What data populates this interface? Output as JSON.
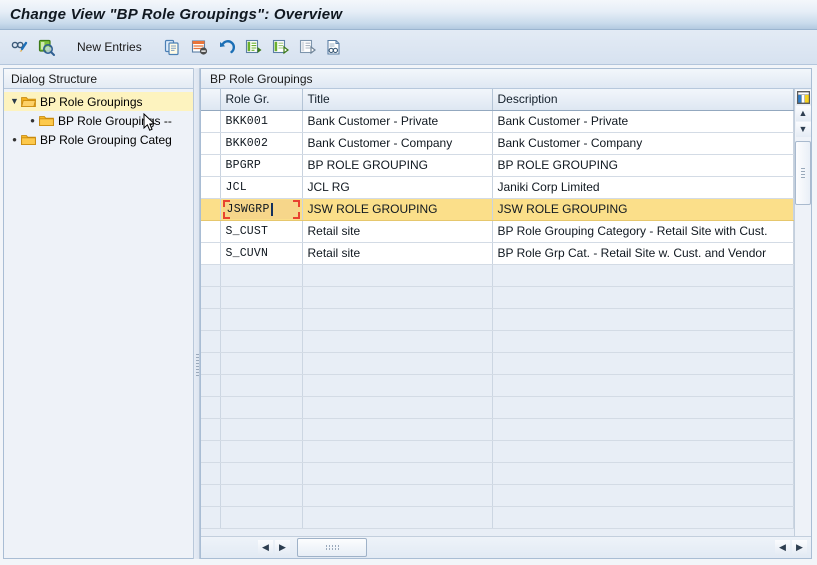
{
  "window": {
    "title": "Change View \"BP Role Groupings\": Overview"
  },
  "toolbar": {
    "icons": [
      {
        "name": "display-change-icon",
        "label": ""
      },
      {
        "name": "search-table-icon",
        "label": ""
      }
    ],
    "new_entries_label": "New Entries",
    "action_icons": [
      {
        "name": "copy-icon"
      },
      {
        "name": "delete-row-icon"
      },
      {
        "name": "undo-icon"
      },
      {
        "name": "select-all-icon"
      },
      {
        "name": "select-block-icon"
      },
      {
        "name": "deselect-icon"
      },
      {
        "name": "display-details-icon"
      }
    ]
  },
  "tree": {
    "header": "Dialog Structure",
    "items": [
      {
        "label": "BP Role Groupings",
        "level": 1,
        "selected": true,
        "expanded": true
      },
      {
        "label": "BP Role Groupings --",
        "level": 2,
        "selected": false,
        "expanded": false
      },
      {
        "label": "BP Role Grouping Categ",
        "level": 1,
        "selected": false,
        "expanded": false
      }
    ]
  },
  "table": {
    "title": "BP Role Groupings",
    "columns": [
      "Role Gr.",
      "Title",
      "Description"
    ],
    "config_icon": "table-settings-icon",
    "rows": [
      {
        "role_gr": "BKK001",
        "title": "Bank Customer - Private",
        "description": "Bank Customer - Private",
        "highlighted": false,
        "editing": false
      },
      {
        "role_gr": "BKK002",
        "title": "Bank Customer - Company",
        "description": "Bank Customer - Company",
        "highlighted": false,
        "editing": false
      },
      {
        "role_gr": "BPGRP",
        "title": "BP ROLE GROUPING",
        "description": "BP ROLE GROUPING",
        "highlighted": false,
        "editing": false
      },
      {
        "role_gr": "JCL",
        "title": "JCL RG",
        "description": "Janiki Corp Limited",
        "highlighted": false,
        "editing": false
      },
      {
        "role_gr": "JSWGRP",
        "title": "JSW ROLE GROUPING",
        "description": "JSW ROLE GROUPING",
        "highlighted": true,
        "editing": true
      },
      {
        "role_gr": "S_CUST",
        "title": "Retail site",
        "description": "BP Role Grouping Category - Retail Site with Cust.",
        "highlighted": false,
        "editing": false
      },
      {
        "role_gr": "S_CUVN",
        "title": "Retail site",
        "description": "BP Role Grp Cat. - Retail Site w. Cust. and Vendor",
        "highlighted": false,
        "editing": false
      }
    ],
    "empty_row_count": 12
  },
  "colors": {
    "highlight_row": "#fbdf8a",
    "edit_border": "#e8422f",
    "tree_selection": "#fdf3bf",
    "header_gradient_top": "#f2f6fb",
    "header_gradient_bottom": "#dee7f2",
    "folder": "#f5b21e"
  },
  "scrollbars": {
    "vertical_up": "▲",
    "vertical_down": "▼",
    "horizontal_left": "◀",
    "horizontal_right": "▶"
  }
}
